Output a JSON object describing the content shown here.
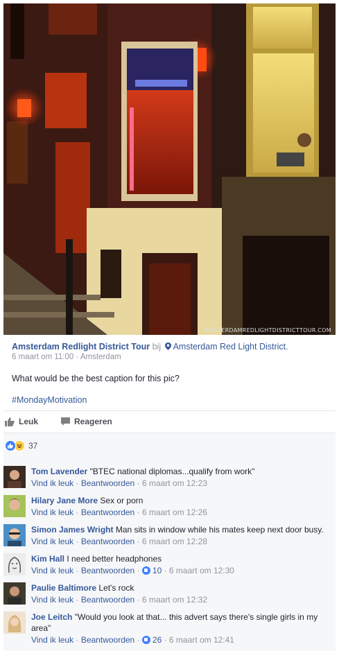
{
  "photo": {
    "watermark": "AmsterdamRedLightDistrictTour.com"
  },
  "post": {
    "page_name": "Amsterdam Redlight District Tour",
    "bij": "bij",
    "place": "Amsterdam Red Light District.",
    "date": "6 maart om 11:00",
    "sep": "·",
    "location": "Amsterdam",
    "caption": "What would be the best caption for this pic?",
    "hashtag": "#MondayMotivation"
  },
  "actions": {
    "like_label": "Leuk",
    "comment_label": "Reageren"
  },
  "reactions": {
    "count": "37"
  },
  "comments": [
    {
      "name": "Tom Lavender",
      "text": "\"BTEC national diplomas...qualify from work\"",
      "like": "Vind ik leuk",
      "reply": "Beantwoorden",
      "likes": "",
      "time": "6 maart om 12:23",
      "avatar_color": "#5a3b2e"
    },
    {
      "name": "Hilary Jane More",
      "text": "Sex or porn",
      "like": "Vind ik leuk",
      "reply": "Beantwoorden",
      "likes": "",
      "time": "6 maart om 12:26",
      "avatar_color": "#8bb04a"
    },
    {
      "name": "Simon James Wright",
      "text": "Man sits in window while his mates keep next door busy.",
      "like": "Vind ik leuk",
      "reply": "Beantwoorden",
      "likes": "",
      "time": "6 maart om 12:28",
      "avatar_color": "#3b7fb7"
    },
    {
      "name": "Kim Hall",
      "text": "I need better headphones",
      "like": "Vind ik leuk",
      "reply": "Beantwoorden",
      "likes": "10",
      "time": "6 maart om 12:30",
      "avatar_color": "#c9c9c9"
    },
    {
      "name": "Paulie Baltimore",
      "text": "Let's rock",
      "like": "Vind ik leuk",
      "reply": "Beantwoorden",
      "likes": "",
      "time": "6 maart om 12:32",
      "avatar_color": "#4a4436"
    },
    {
      "name": "Joe Leitch",
      "text": "\"Would you look at that... this advert says there's single girls in my area\"",
      "like": "Vind ik leuk",
      "reply": "Beantwoorden",
      "likes": "26",
      "time": "6 maart om 12:41",
      "avatar_color": "#e6cdb3"
    }
  ]
}
